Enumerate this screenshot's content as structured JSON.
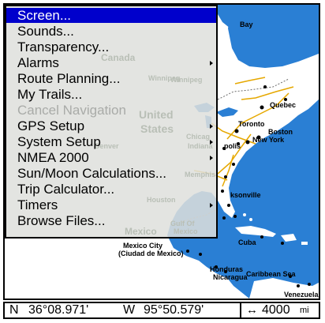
{
  "menu": {
    "items": [
      {
        "label": "Screen...",
        "selected": true,
        "disabled": false,
        "submenu": false
      },
      {
        "label": "Sounds...",
        "selected": false,
        "disabled": false,
        "submenu": false
      },
      {
        "label": "Transparency...",
        "selected": false,
        "disabled": false,
        "submenu": false
      },
      {
        "label": "Alarms",
        "selected": false,
        "disabled": false,
        "submenu": true
      },
      {
        "label": "Route Planning...",
        "selected": false,
        "disabled": false,
        "submenu": false
      },
      {
        "label": "My Trails...",
        "selected": false,
        "disabled": false,
        "submenu": false
      },
      {
        "label": "Cancel Navigation",
        "selected": false,
        "disabled": true,
        "submenu": false
      },
      {
        "label": "GPS Setup",
        "selected": false,
        "disabled": false,
        "submenu": true
      },
      {
        "label": "System Setup",
        "selected": false,
        "disabled": false,
        "submenu": true
      },
      {
        "label": "NMEA 2000",
        "selected": false,
        "disabled": false,
        "submenu": true
      },
      {
        "label": "Sun/Moon Calculations...",
        "selected": false,
        "disabled": false,
        "submenu": false
      },
      {
        "label": "Trip Calculator...",
        "selected": false,
        "disabled": false,
        "submenu": false
      },
      {
        "label": "Timers",
        "selected": false,
        "disabled": false,
        "submenu": true
      },
      {
        "label": "Browse Files...",
        "selected": false,
        "disabled": false,
        "submenu": false
      }
    ]
  },
  "map": {
    "labels": {
      "bay": "Bay",
      "quebec": "Quebec",
      "toronto": "Toronto",
      "boston": "Boston",
      "new_york": "New York",
      "minneapolis": "polis",
      "jacksonville": "ksonville",
      "mexico_city": "Mexico City",
      "ciudad": "(Ciudad de Mexico)",
      "cuba": "Cuba",
      "honduras": "Honduras",
      "nicaragua": "Nicaragua",
      "caribbean": "Caribbean Sea",
      "venezuela": "Venezuela",
      "canada": "Canada",
      "winnipeg": "Winnipeg",
      "united": "United",
      "states": "States",
      "denver": "Denver",
      "chicago": "Chicag",
      "indianapolis": "Indiana",
      "memphis": "Memphis",
      "houston": "Houston",
      "gulf_of": "Gulf Of",
      "gulf_mexico": "Mexico",
      "mexico": "Mexico"
    },
    "colors": {
      "land": "#ffffff",
      "water": "#2a7fd4",
      "roads": "#e6a800"
    }
  },
  "status": {
    "lat_hem": "N",
    "lat": "36°08.971'",
    "lon_hem": "W",
    "lon": "95°50.579'",
    "zoom_icon": "range-arrows-icon",
    "zoom_value": "4000",
    "zoom_unit": "mi"
  }
}
